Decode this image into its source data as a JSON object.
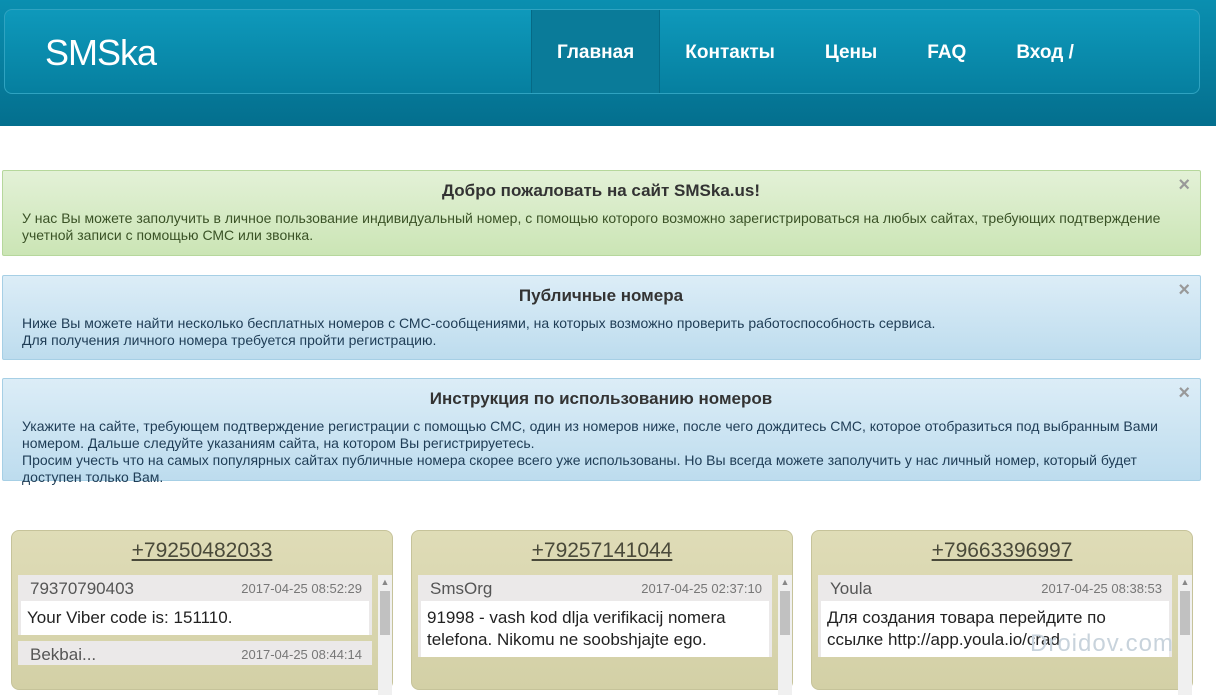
{
  "header": {
    "brand": "SMSka",
    "nav": [
      "Главная",
      "Контакты",
      "Цены",
      "FAQ",
      "Вход / Регистрация"
    ]
  },
  "alerts": [
    {
      "title": "Добро пожаловать на сайт SMSka.us!",
      "lines": [
        "У нас Вы можете заполучить в личное пользование индивидуальный номер, с помощью которого возможно зарегистрироваться на любых сайтах, требующих подтверждение учетной записи с помощью СМС или звонка."
      ],
      "close": "×"
    },
    {
      "title": "Публичные номера",
      "lines": [
        "Ниже Вы можете найти несколько бесплатных номеров с СМС-сообщениями, на которых возможно проверить работоспособность сервиса.",
        "Для получения личного номера требуется пройти регистрацию."
      ],
      "close": "×"
    },
    {
      "title": "Инструкция по использованию номеров",
      "lines": [
        "Укажите на сайте, требующем подтверждение регистрации с помощью СМС, один из номеров ниже, после чего дождитесь СМС, которое отобразиться под выбранным Вами номером. Дальше следуйте указаниям сайта, на котором Вы регистрируетесь.",
        "Просим учесть что на самых популярных сайтах публичные номера скорее всего уже использованы. Но Вы всегда можете заполучить у нас личный номер, который будет доступен только Вам."
      ],
      "close": "×"
    }
  ],
  "cards": [
    {
      "phone": "+79250482033",
      "messages": [
        {
          "sender": "79370790403",
          "time": "2017-04-25 08:52:29",
          "text": "Your Viber code is: 151110."
        },
        {
          "sender": "Bekbai...",
          "time": "2017-04-25 08:44:14",
          "text": ""
        }
      ]
    },
    {
      "phone": "+79257141044",
      "messages": [
        {
          "sender": "SmsOrg",
          "time": "2017-04-25 02:37:10",
          "text": "91998 - vash kod dlja verifikacij nomera telefona. Nikomu ne soobshjajte ego."
        }
      ]
    },
    {
      "phone": "+79663396997",
      "messages": [
        {
          "sender": "Youla",
          "time": "2017-04-25 08:38:53",
          "text": "Для создания товара перейдите по ссылке http://app.youla.io/crad"
        }
      ]
    }
  ],
  "icons": {
    "close": "close-icon",
    "scroll_up": "scroll-up-icon"
  },
  "colors": {
    "header": "#067f9f",
    "green_alert": "#d6ebc5",
    "blue_alert": "#cce5f3",
    "card": "#d9d6ae"
  },
  "watermark": "Droidov.com"
}
